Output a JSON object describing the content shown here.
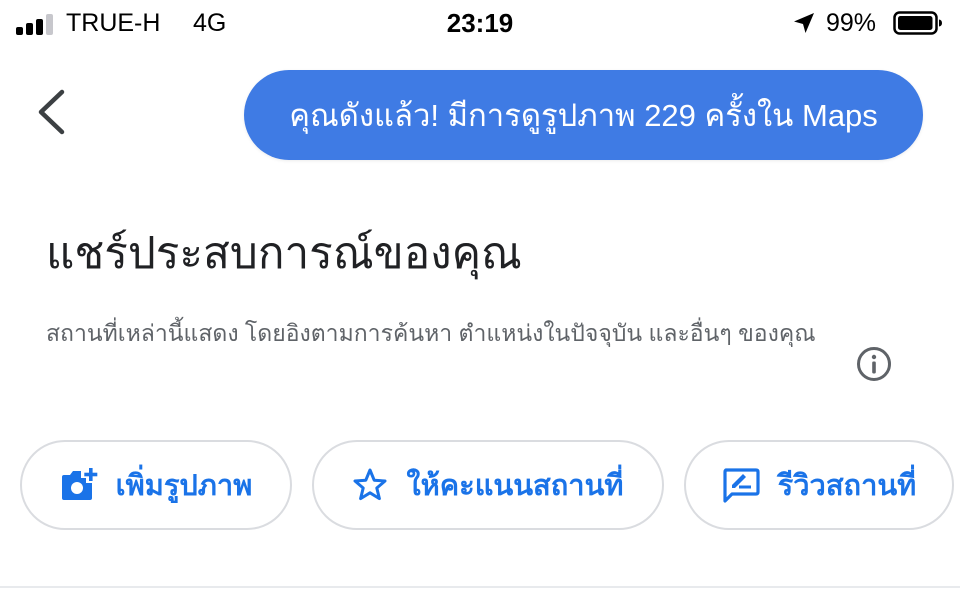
{
  "status_bar": {
    "carrier": "TRUE-H",
    "network": "4G",
    "time": "23:19",
    "battery_percent": "99%",
    "location_icon": "location-arrow-icon",
    "signal_bars_active": 3,
    "signal_bars_total": 4
  },
  "header": {
    "back_icon": "chevron-left-icon",
    "banner_text": "คุณดังแล้ว! มีการดูรูปภาพ 229 ครั้งใน Maps"
  },
  "main": {
    "title": "แชร์ประสบการณ์ของคุณ",
    "description": "สถานที่เหล่านี้แสดง โดยอิงตามการค้นหา ตำแหน่งในปัจจุบัน และอื่นๆ ของคุณ",
    "info_icon": "info-icon"
  },
  "actions": [
    {
      "label": "เพิ่มรูปภาพ",
      "icon": "add-photo-icon"
    },
    {
      "label": "ให้คะแนนสถานที่",
      "icon": "star-outline-icon"
    },
    {
      "label": "รีวิวสถานที่",
      "icon": "rate-review-icon"
    }
  ],
  "colors": {
    "banner_bg": "#3f7be4",
    "accent": "#1a73e8",
    "chip_border": "#dadce0",
    "secondary_text": "#5f6368"
  }
}
